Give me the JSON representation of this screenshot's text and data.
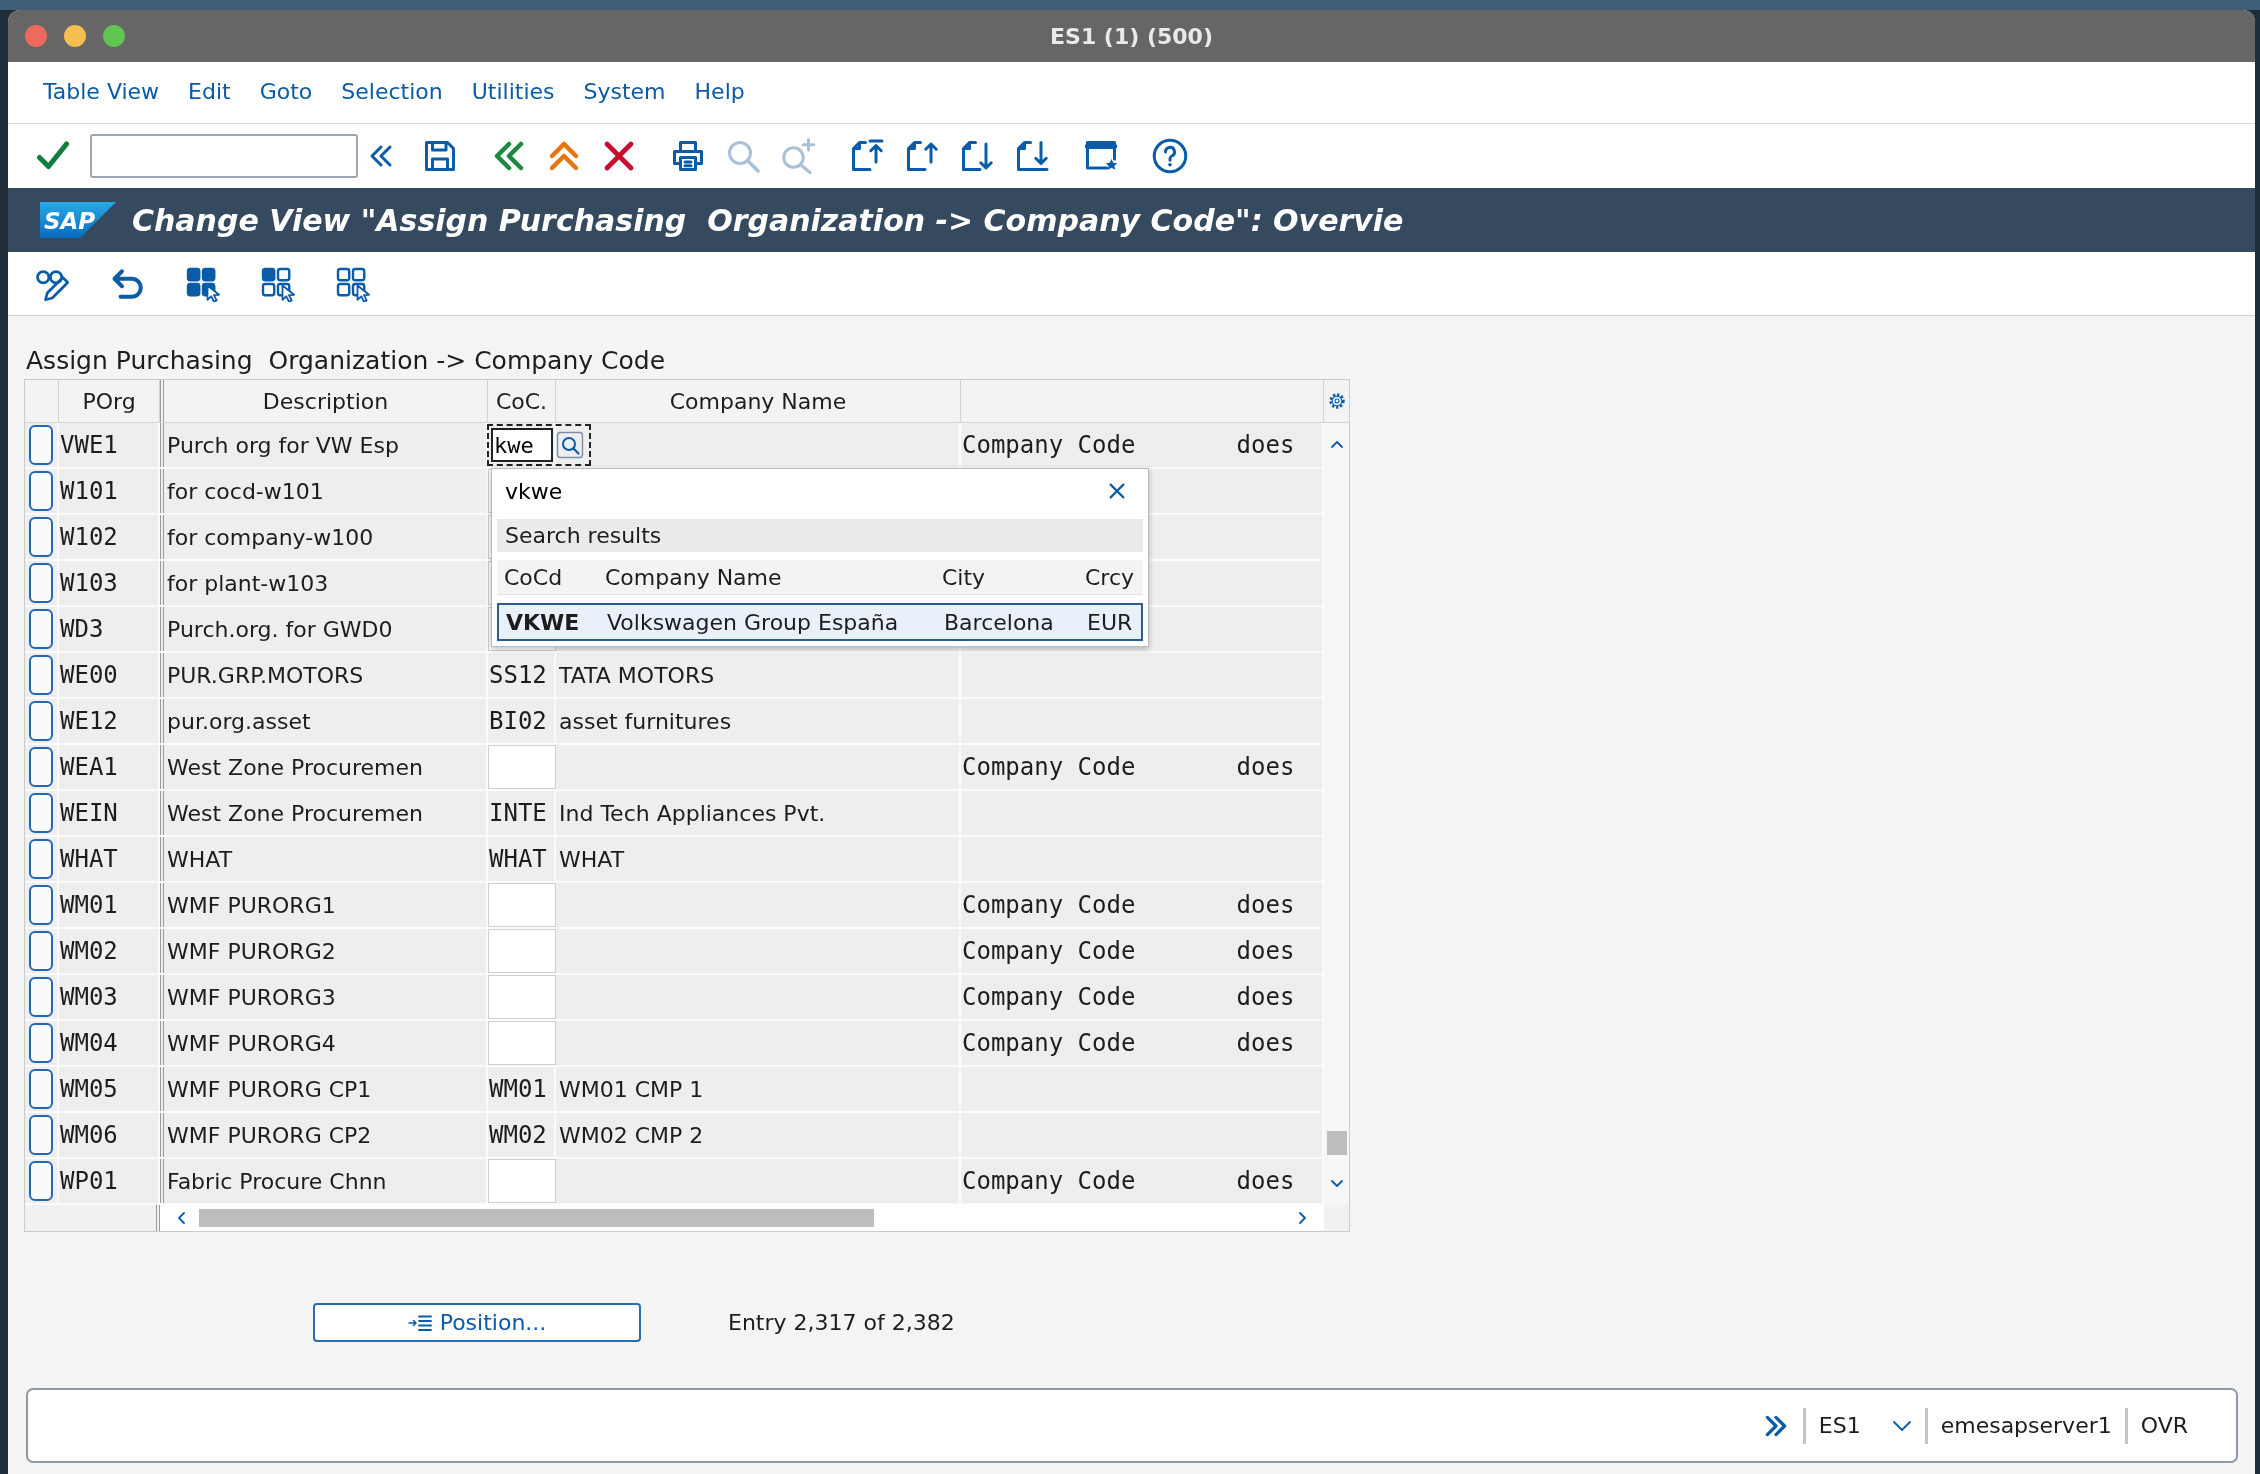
{
  "window": {
    "title": "ES1 (1) (500)"
  },
  "menu": [
    "Table View",
    "Edit",
    "Goto",
    "Selection",
    "Utilities",
    "System",
    "Help"
  ],
  "toolbar": [
    {
      "kind": "enter",
      "disabled": false
    },
    {
      "kind": "command_field",
      "disabled": false
    },
    {
      "kind": "collapse",
      "disabled": false
    },
    {
      "kind": "save",
      "disabled": false
    },
    {
      "kind": "back",
      "disabled": false
    },
    {
      "kind": "exit",
      "disabled": false
    },
    {
      "kind": "cancel",
      "disabled": false
    },
    {
      "kind": "print",
      "disabled": false
    },
    {
      "kind": "find",
      "disabled": true
    },
    {
      "kind": "find_next",
      "disabled": true
    },
    {
      "kind": "first_page",
      "disabled": false
    },
    {
      "kind": "previous_page",
      "disabled": false
    },
    {
      "kind": "next_page",
      "disabled": false
    },
    {
      "kind": "last_page",
      "disabled": false
    },
    {
      "kind": "layout",
      "disabled": false
    },
    {
      "kind": "help",
      "disabled": false
    }
  ],
  "title_bar": {
    "logo": "SAP",
    "title": "Change View \"Assign Purchasing  Organization -> Company Code\": Overvie"
  },
  "app_toolbar": [
    {
      "kind": "display_change"
    },
    {
      "kind": "undo"
    },
    {
      "kind": "select_all"
    },
    {
      "kind": "select_block"
    },
    {
      "kind": "deselect_all"
    }
  ],
  "table": {
    "caption": "Assign Purchasing  Organization -> Company Code",
    "columns": [
      "POrg",
      "Description",
      "CoC.",
      "Company Name"
    ],
    "rows": [
      {
        "selected": false,
        "focused": true,
        "porg": "VWE1",
        "description": "Purch org for VW Esp",
        "coc": "kwe",
        "column_6": "Company Code       does"
      },
      {
        "selected": false,
        "focused": false,
        "porg": "W101",
        "description": "for cocd-w101"
      },
      {
        "selected": false,
        "focused": false,
        "porg": "W102",
        "description": "for company-w100"
      },
      {
        "selected": false,
        "focused": false,
        "porg": "W103",
        "description": "for plant-w103"
      },
      {
        "selected": false,
        "focused": false,
        "porg": "WD3",
        "description": "Purch.org. for GWD0"
      },
      {
        "selected": false,
        "focused": false,
        "porg": "WE00",
        "description": "PUR.GRP.MOTORS",
        "coc": "SS12",
        "company_name": "TATA MOTORS"
      },
      {
        "selected": false,
        "focused": false,
        "porg": "WE12",
        "description": "pur.org.asset",
        "coc": "BI02",
        "company_name": "asset furnitures"
      },
      {
        "selected": false,
        "focused": false,
        "porg": "WEA1",
        "description": "West Zone Procuremen",
        "column_6": "Company Code       does"
      },
      {
        "selected": false,
        "focused": false,
        "porg": "WEIN",
        "description": "West Zone Procuremen",
        "coc": "INTE",
        "company_name": "Ind Tech Appliances Pvt."
      },
      {
        "selected": false,
        "focused": false,
        "porg": "WHAT",
        "description": "WHAT",
        "coc": "WHAT",
        "company_name": "WHAT"
      },
      {
        "selected": false,
        "focused": false,
        "porg": "WM01",
        "description": "WMF PURORG1",
        "column_6": "Company Code       does"
      },
      {
        "selected": false,
        "focused": false,
        "porg": "WM02",
        "description": "WMF PURORG2",
        "column_6": "Company Code       does"
      },
      {
        "selected": false,
        "focused": false,
        "porg": "WM03",
        "description": "WMF PURORG3",
        "column_6": "Company Code       does"
      },
      {
        "selected": false,
        "focused": false,
        "porg": "WM04",
        "description": "WMF PURORG4",
        "column_6": "Company Code       does"
      },
      {
        "selected": false,
        "focused": false,
        "porg": "WM05",
        "description": "WMF PURORG CP1",
        "coc": "WM01",
        "company_name": "WM01 CMP 1"
      },
      {
        "selected": false,
        "focused": false,
        "porg": "WM06",
        "description": "WMF PURORG CP2",
        "coc": "WM02",
        "company_name": "WM02 CMP 2"
      },
      {
        "selected": false,
        "focused": false,
        "porg": "WP01",
        "description": "Fabric Procure Chnn",
        "column_6": "Company Code       does"
      }
    ]
  },
  "search_help": {
    "query": "vkwe",
    "heading": "Search results",
    "columns": [
      "CoCd",
      "Company Name",
      "City",
      "Crcy"
    ],
    "results": [
      {
        "selected": true,
        "cells": [
          "VKWE",
          "Volkswagen Group España",
          "Barcelona",
          "EUR"
        ]
      }
    ]
  },
  "position_button": "Position...",
  "entry_info": "Entry 2,317 of 2,382",
  "status_bar": {
    "system": "ES1",
    "server": "emesapserver1",
    "mode": "OVR"
  }
}
